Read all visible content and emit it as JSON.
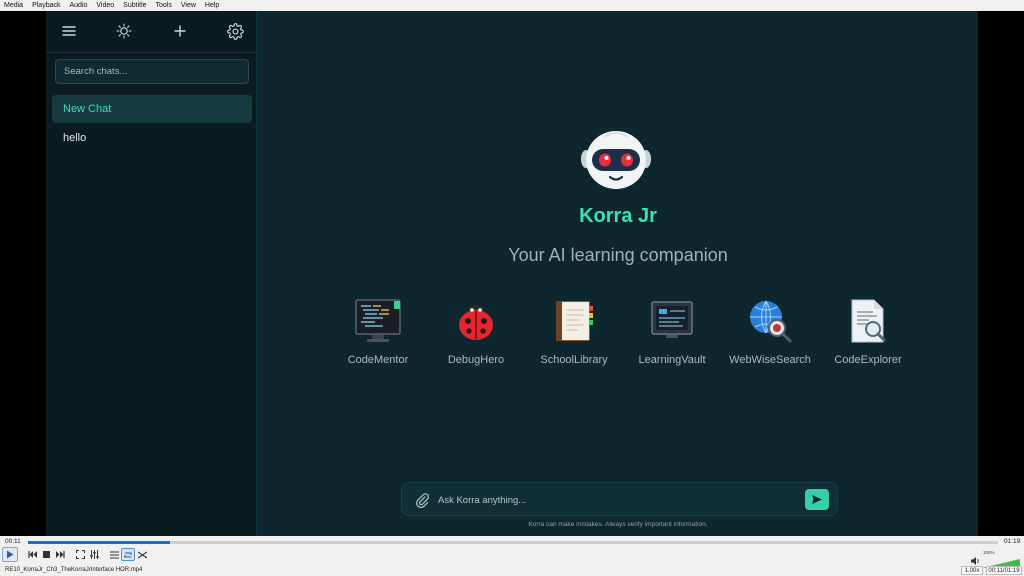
{
  "player": {
    "menu": [
      "Media",
      "Playback",
      "Audio",
      "Video",
      "Subtitle",
      "Tools",
      "View",
      "Help"
    ],
    "elapsed": "00:11",
    "duration": "01:19",
    "progress": 0.146,
    "filename": "RE10_KorraJr_Ch3_TheKorraJrInterface HOR.mp4",
    "rate": "1.00x",
    "clock": "00:11/01:19",
    "volume": "100%",
    "volume_level": 1.0
  },
  "sidebar": {
    "toolbar_icons": [
      "menu-icon",
      "sun-icon",
      "plus-icon",
      "gear-icon"
    ],
    "search_placeholder": "Search chats...",
    "chats": [
      {
        "label": "New Chat",
        "active": true
      },
      {
        "label": "hello",
        "active": false
      }
    ]
  },
  "main": {
    "title": "Korra Jr",
    "subtitle": "Your AI learning companion",
    "tools": [
      {
        "label": "CodeMentor",
        "icon": "code-monitor-icon"
      },
      {
        "label": "DebugHero",
        "icon": "ladybug-icon"
      },
      {
        "label": "SchoolLibrary",
        "icon": "book-icon"
      },
      {
        "label": "LearningVault",
        "icon": "vault-screen-icon"
      },
      {
        "label": "WebWiseSearch",
        "icon": "globe-search-icon"
      },
      {
        "label": "CodeExplorer",
        "icon": "document-search-icon"
      }
    ],
    "input_placeholder": "Ask Korra anything...",
    "disclaimer": "Korra can make mistakes. Always verify important information."
  },
  "colors": {
    "accent": "#3ee0b8",
    "app_bg": "#0e262d",
    "sidebar_bg": "#0b1c21"
  }
}
